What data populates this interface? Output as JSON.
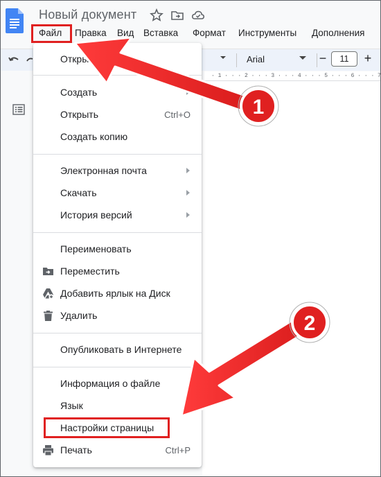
{
  "app": {
    "title": "Новый документ"
  },
  "menubar": {
    "items": [
      "Файл",
      "Правка",
      "Вид",
      "Вставка",
      "Формат",
      "Инструменты",
      "Дополнения"
    ]
  },
  "toolbar": {
    "font": "Arial",
    "font_size": "11",
    "minus": "−",
    "plus": "+",
    "ruler": "· 1 · · · 2 · · · 3 · · · 4 · · · 5 · · · 6 · · · 7"
  },
  "file_menu": {
    "items": [
      {
        "label": "Открыть",
        "shortcut": "",
        "submenu": false,
        "icon": ""
      },
      {
        "label": "Создать",
        "shortcut": "",
        "submenu": true,
        "icon": ""
      },
      {
        "label": "Открыть",
        "shortcut": "Ctrl+O",
        "submenu": false,
        "icon": ""
      },
      {
        "label": "Создать копию",
        "shortcut": "",
        "submenu": false,
        "icon": ""
      },
      {
        "label": "Электронная почта",
        "shortcut": "",
        "submenu": true,
        "icon": ""
      },
      {
        "label": "Скачать",
        "shortcut": "",
        "submenu": true,
        "icon": ""
      },
      {
        "label": "История версий",
        "shortcut": "",
        "submenu": true,
        "icon": ""
      },
      {
        "label": "Переименовать",
        "shortcut": "",
        "submenu": false,
        "icon": ""
      },
      {
        "label": "Переместить",
        "shortcut": "",
        "submenu": false,
        "icon": "move-folder-icon"
      },
      {
        "label": "Добавить ярлык на Диск",
        "shortcut": "",
        "submenu": false,
        "icon": "drive-shortcut-icon"
      },
      {
        "label": "Удалить",
        "shortcut": "",
        "submenu": false,
        "icon": "trash-icon"
      },
      {
        "label": "Опубликовать в Интернете",
        "shortcut": "",
        "submenu": false,
        "icon": ""
      },
      {
        "label": "Информация о файле",
        "shortcut": "",
        "submenu": false,
        "icon": ""
      },
      {
        "label": "Язык",
        "shortcut": "",
        "submenu": false,
        "icon": ""
      },
      {
        "label": "Настройки страницы",
        "shortcut": "",
        "submenu": false,
        "icon": ""
      },
      {
        "label": "Печать",
        "shortcut": "Ctrl+P",
        "submenu": false,
        "icon": "print-icon"
      }
    ]
  },
  "annotations": {
    "badge_1": "1",
    "badge_2": "2"
  },
  "colors": {
    "accent_red": "#e02020",
    "docs_blue": "#4285f4",
    "toolbar_bg": "#edf2fa"
  }
}
